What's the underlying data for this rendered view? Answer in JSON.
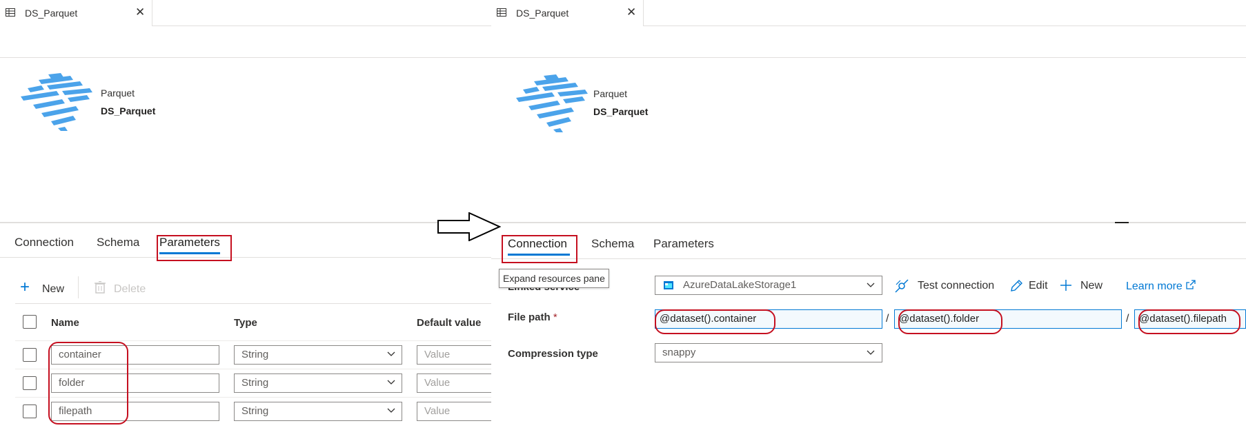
{
  "left": {
    "doc_tab": {
      "title": "DS_Parquet",
      "close_glyph": "✕",
      "icon": "table-icon"
    },
    "dataset": {
      "type": "Parquet",
      "name": "DS_Parquet",
      "logo_icon": "parquet-logo-icon"
    },
    "tabs": [
      {
        "label": "Connection",
        "active": false
      },
      {
        "label": "Schema",
        "active": false
      },
      {
        "label": "Parameters",
        "active": true
      }
    ],
    "toolbar": {
      "new_label": "New",
      "delete_label": "Delete",
      "plus_glyph": "+"
    },
    "table": {
      "headers": {
        "name": "Name",
        "type": "Type",
        "default": "Default value"
      },
      "rows": [
        {
          "name": "container",
          "type": "String",
          "default_placeholder": "Value"
        },
        {
          "name": "folder",
          "type": "String",
          "default_placeholder": "Value"
        },
        {
          "name": "filepath",
          "type": "String",
          "default_placeholder": "Value"
        }
      ]
    }
  },
  "right": {
    "doc_tab": {
      "title": "DS_Parquet",
      "close_glyph": "✕",
      "icon": "table-icon"
    },
    "dataset": {
      "type": "Parquet",
      "name": "DS_Parquet",
      "logo_icon": "parquet-logo-icon"
    },
    "tabs": [
      {
        "label": "Connection",
        "active": true
      },
      {
        "label": "Schema",
        "active": false
      },
      {
        "label": "Parameters",
        "active": false
      }
    ],
    "tooltip": "Expand resources pane",
    "linked_service": {
      "label": "Linked service",
      "value": "AzureDataLakeStorage1"
    },
    "actions": {
      "test_connection": "Test connection",
      "edit": "Edit",
      "new": "New",
      "learn_more": "Learn more"
    },
    "file_path": {
      "label": "File path",
      "required_mark": "*",
      "separator": "/",
      "container": "@dataset().container",
      "folder": "@dataset().folder",
      "filepath": "@dataset().filepath"
    },
    "compression": {
      "label": "Compression type",
      "value": "snappy"
    }
  },
  "colors": {
    "accent": "#0078d4",
    "annotation": "#c50f1f",
    "logo": "#4ba3ea"
  }
}
